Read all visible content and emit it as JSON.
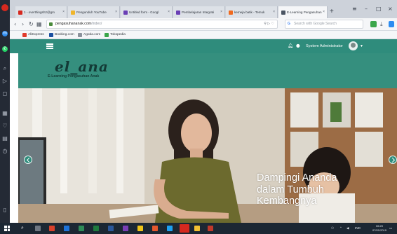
{
  "browser": {
    "tabs": [
      {
        "label": "1 - overthingsh2@gm",
        "color": "#d6291f"
      },
      {
        "label": "Pengunduh YouTube",
        "color": "#f0b52b"
      },
      {
        "label": "Untitled form - Googl",
        "color": "#6a3fb5"
      },
      {
        "label": "Pembelajaran Integrati",
        "color": "#6a3fb5"
      },
      {
        "label": "kemeja batik - Temuk",
        "color": "#f06a1f"
      },
      {
        "label": "E-Learning Pengasuhan",
        "color": "#4b5563"
      }
    ],
    "new_tab_label": "+",
    "url_host": "pengasuhananak.com",
    "url_path": "/index/",
    "search_placeholder": "Search with Google Search",
    "search_engine_glyph": "G",
    "bookmarks": [
      {
        "label": "AliExpress",
        "color": "#e03a2c"
      },
      {
        "label": "Booking.com",
        "color": "#1b4fa0"
      },
      {
        "label": "Agoda.com",
        "color": "#8b929c"
      },
      {
        "label": "Tokopedia",
        "color": "#3aa64a"
      }
    ]
  },
  "site": {
    "header": {
      "user_name": "System Administrator",
      "nav_color": "#2f8c7c"
    },
    "brand": {
      "title": "el_ana",
      "subtitle": "E-Learning Pengasuhan Anak"
    },
    "carousel": {
      "caption": "Dampingi Ananda\ndalam Tumbuh\nKembangnya"
    }
  },
  "taskbar": {
    "language": "IND",
    "time": "06:20",
    "date": "07/01/2019"
  }
}
